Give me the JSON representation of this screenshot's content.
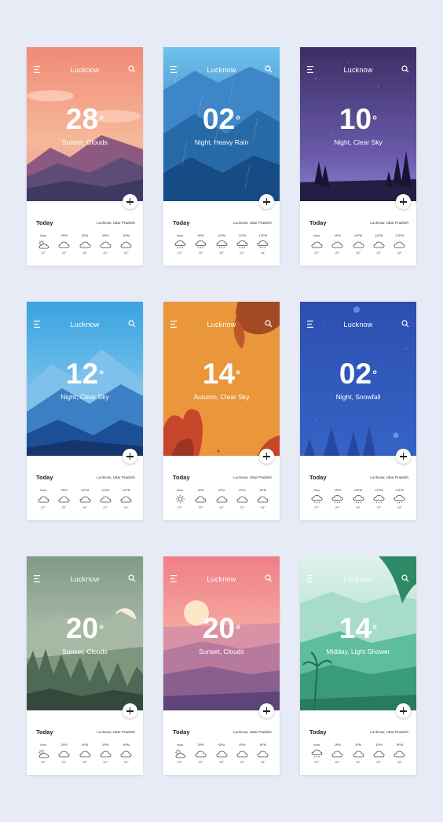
{
  "cards": [
    {
      "city": "Lucknow",
      "temp": "28",
      "condition": "Sunset, Clouds",
      "today": "Today",
      "location": "Lucknow, Uttar Pradesh",
      "hours": [
        {
          "time": "Now",
          "icon": "sun-cloud-icon",
          "temp": "22°"
        },
        {
          "time": "3PM",
          "icon": "cloud-icon",
          "temp": "20°"
        },
        {
          "time": "4PM",
          "icon": "cloud-icon",
          "temp": "18°"
        },
        {
          "time": "5PM",
          "icon": "cloud-icon",
          "temp": "22°"
        },
        {
          "time": "6PM",
          "icon": "cloud-icon",
          "temp": "16°"
        }
      ]
    },
    {
      "city": "Lucknow",
      "temp": "02",
      "condition": "Night, Heavy Rain",
      "today": "Today",
      "location": "Lucknow, Uttar Pradesh",
      "hours": [
        {
          "time": "Now",
          "icon": "rain-cloud-icon",
          "temp": "22°"
        },
        {
          "time": "9PM",
          "icon": "rain-cloud-icon",
          "temp": "20°"
        },
        {
          "time": "10PM",
          "icon": "rain-cloud-icon",
          "temp": "18°"
        },
        {
          "time": "11PM",
          "icon": "rain-cloud-icon",
          "temp": "22°"
        },
        {
          "time": "12PM",
          "icon": "rain-cloud-icon",
          "temp": "16°"
        }
      ]
    },
    {
      "city": "Lucknow",
      "temp": "10",
      "condition": "Night, Clear Sky",
      "today": "Today",
      "location": "Lucknow, Uttar Pradesh",
      "hours": [
        {
          "time": "Now",
          "icon": "cloud-icon",
          "temp": "22°"
        },
        {
          "time": "9PM",
          "icon": "cloud-icon",
          "temp": "20°"
        },
        {
          "time": "10PM",
          "icon": "cloud-icon",
          "temp": "18°"
        },
        {
          "time": "11PM",
          "icon": "cloud-icon",
          "temp": "22°"
        },
        {
          "time": "12PM",
          "icon": "cloud-icon",
          "temp": "16°"
        }
      ]
    },
    {
      "city": "Lucknow",
      "temp": "12",
      "condition": "Night, Clear Sky",
      "today": "Today",
      "location": "Lucknow, Uttar Pradesh",
      "hours": [
        {
          "time": "Now",
          "icon": "cloud-icon",
          "temp": "22°"
        },
        {
          "time": "9PM",
          "icon": "cloud-icon",
          "temp": "20°"
        },
        {
          "time": "10PM",
          "icon": "cloud-icon",
          "temp": "18°"
        },
        {
          "time": "11PM",
          "icon": "cloud-icon",
          "temp": "22°"
        },
        {
          "time": "12PM",
          "icon": "cloud-icon",
          "temp": "16°"
        }
      ]
    },
    {
      "city": "Lucknow",
      "temp": "14",
      "condition": "Autumn, Clear Sky",
      "today": "Today",
      "location": "Lucknow, Uttar Pradesh",
      "hours": [
        {
          "time": "Now",
          "icon": "sun-icon",
          "temp": "22°"
        },
        {
          "time": "3PM",
          "icon": "cloud-icon",
          "temp": "20°"
        },
        {
          "time": "4PM",
          "icon": "cloud-icon",
          "temp": "18°"
        },
        {
          "time": "5PM",
          "icon": "cloud-icon",
          "temp": "22°"
        },
        {
          "time": "6PM",
          "icon": "cloud-icon",
          "temp": "16°"
        }
      ]
    },
    {
      "city": "Lucknow",
      "temp": "02",
      "condition": "Night, Snowfall",
      "today": "Today",
      "location": "Lucknow, Uttar Pradesh",
      "hours": [
        {
          "time": "Now",
          "icon": "snow-cloud-icon",
          "temp": "22°"
        },
        {
          "time": "9PM",
          "icon": "snow-cloud-icon",
          "temp": "20°"
        },
        {
          "time": "10PM",
          "icon": "snow-cloud-icon",
          "temp": "18°"
        },
        {
          "time": "11PM",
          "icon": "snow-cloud-icon",
          "temp": "22°"
        },
        {
          "time": "12PM",
          "icon": "snow-cloud-icon",
          "temp": "16°"
        }
      ]
    },
    {
      "city": "Lucknow",
      "temp": "20",
      "condition": "Sunset, Clouds",
      "today": "Today",
      "location": "Lucknow, Uttar Pradesh",
      "hours": [
        {
          "time": "Now",
          "icon": "sun-cloud-icon",
          "temp": "22°"
        },
        {
          "time": "3PM",
          "icon": "cloud-icon",
          "temp": "20°"
        },
        {
          "time": "4PM",
          "icon": "cloud-icon",
          "temp": "18°"
        },
        {
          "time": "5PM",
          "icon": "cloud-icon",
          "temp": "22°"
        },
        {
          "time": "6PM",
          "icon": "cloud-icon",
          "temp": "16°"
        }
      ]
    },
    {
      "city": "Lucknow",
      "temp": "20",
      "condition": "Sunset, Clouds",
      "today": "Today",
      "location": "Lucknow, Uttar Pradesh",
      "hours": [
        {
          "time": "Now",
          "icon": "sun-cloud-icon",
          "temp": "22°"
        },
        {
          "time": "3PM",
          "icon": "cloud-icon",
          "temp": "20°"
        },
        {
          "time": "4PM",
          "icon": "cloud-icon",
          "temp": "18°"
        },
        {
          "time": "5PM",
          "icon": "cloud-icon",
          "temp": "22°"
        },
        {
          "time": "6PM",
          "icon": "cloud-icon",
          "temp": "16°"
        }
      ]
    },
    {
      "city": "Lucknow",
      "temp": "14",
      "condition": "Midday, Light Shower",
      "today": "Today",
      "location": "Lucknow, Uttar Pradesh",
      "hours": [
        {
          "time": "Now",
          "icon": "rain-cloud-icon",
          "temp": "22°"
        },
        {
          "time": "2PM",
          "icon": "cloud-icon",
          "temp": "20°"
        },
        {
          "time": "3PM",
          "icon": "cloud-icon",
          "temp": "18°"
        },
        {
          "time": "4PM",
          "icon": "cloud-icon",
          "temp": "22°"
        },
        {
          "time": "5PM",
          "icon": "cloud-icon",
          "temp": "16°"
        }
      ]
    }
  ],
  "colors": {
    "page_bg": "#e7ebf6",
    "text_dark": "#222222",
    "white": "#ffffff"
  }
}
